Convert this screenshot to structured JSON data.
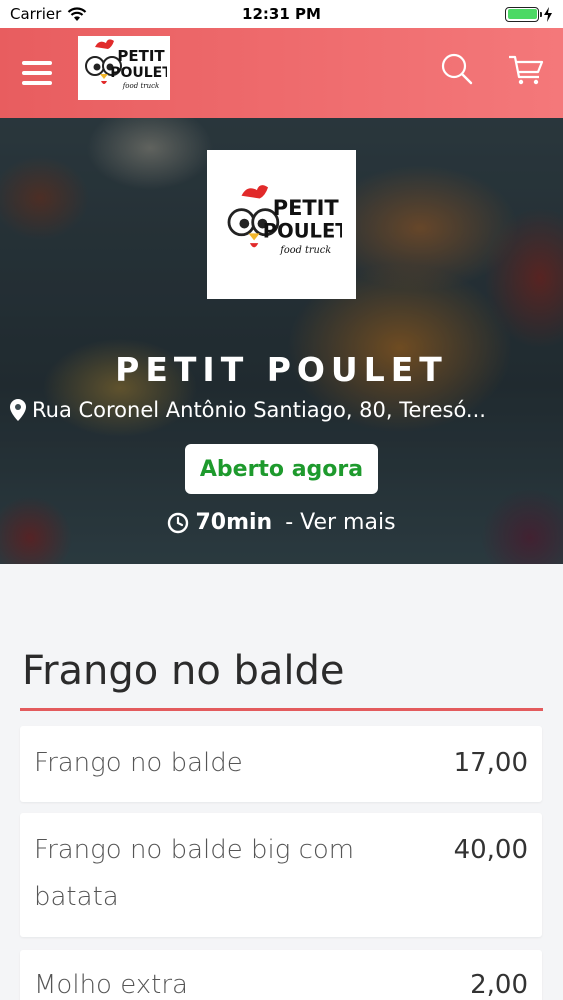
{
  "status_bar": {
    "carrier": "Carrier",
    "time": "12:31 PM"
  },
  "header": {
    "logo_alt": "Petit Poulet food truck"
  },
  "restaurant": {
    "name": "PETIT POULET",
    "address": "Rua Coronel Antônio Santiago, 80, Teresó...",
    "status": "Aberto agora",
    "delivery_time": "70min",
    "more_label": " - Ver mais"
  },
  "logo": {
    "line1": "PETIT",
    "line2": "POULET",
    "line3": "food truck"
  },
  "menu": {
    "section_title": "Frango no balde",
    "items": [
      {
        "name": "Frango no balde",
        "price": "17,00"
      },
      {
        "name": "Frango no balde big com batata",
        "price": "40,00"
      },
      {
        "name": "Molho extra",
        "price": "2,00"
      }
    ]
  },
  "colors": {
    "accent": "#e85d5f",
    "open_green": "#1e9a2d"
  },
  "icons": [
    "wifi-icon",
    "battery-icon",
    "charging-icon",
    "menu-icon",
    "search-icon",
    "cart-icon",
    "location-pin-icon",
    "clock-icon"
  ]
}
